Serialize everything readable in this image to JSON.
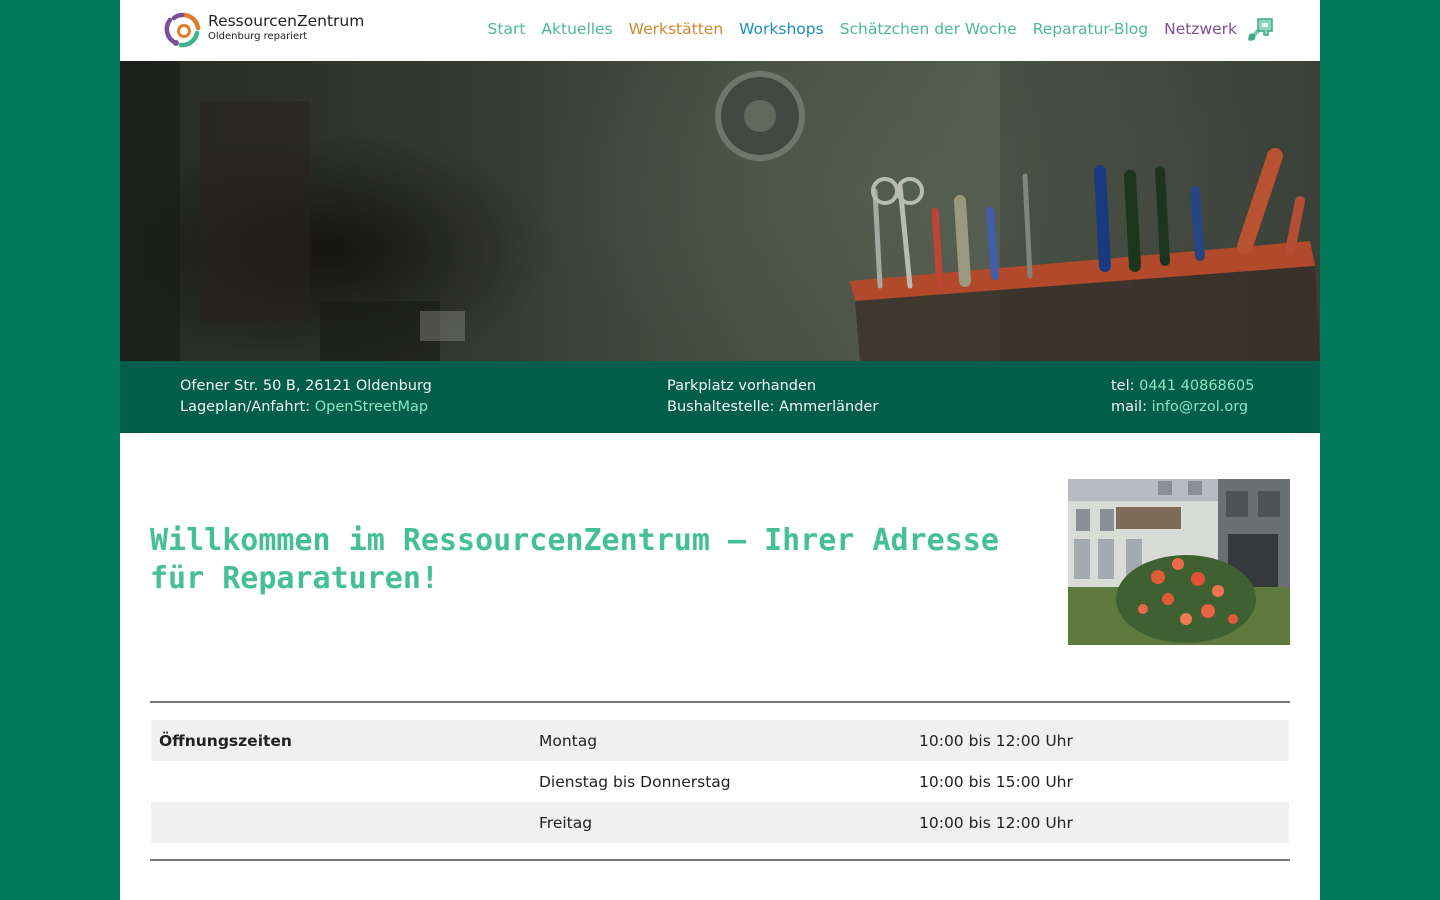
{
  "header": {
    "logo": {
      "name": "RessourcenZentrum",
      "subtitle": "Oldenburg repariert",
      "icon": "circular-arrows-logo-icon"
    },
    "nav": [
      {
        "label": "Start",
        "color": "#4db89a"
      },
      {
        "label": "Aktuelles",
        "color": "#4db89a"
      },
      {
        "label": "Werkstätten",
        "color": "#d08a30"
      },
      {
        "label": "Workshops",
        "color": "#1a8fb8"
      },
      {
        "label": "Schätzchen der Woche",
        "color": "#4db89a"
      },
      {
        "label": "Reparatur-Blog",
        "color": "#4db89a"
      },
      {
        "label": "Netzwerk",
        "color": "#7d4e99"
      }
    ],
    "network_icon": "puzzle-network-icon"
  },
  "hero": {
    "icon": "workshop-tools-photo"
  },
  "info": {
    "address": "Ofener Str. 50 B, 26121 Oldenburg",
    "map_prefix": "Lageplan/Anfahrt: ",
    "map_link": "OpenStreetMap",
    "parking": "Parkplatz vorhanden",
    "bus": "Bushaltestelle: Ammerländer",
    "tel_prefix": "tel: ",
    "tel": "0441 40868605",
    "mail_prefix": "mail: ",
    "mail": "info@rzol.org"
  },
  "welcome": {
    "title": "Willkommen im RessourcenZentrum – Ihrer Adresse für Reparaturen!",
    "image": "building-with-roses-photo"
  },
  "hours": {
    "heading": "Öffnungszeiten",
    "rows": [
      {
        "label": "Öffnungszeiten",
        "day": "Montag",
        "time": "10:00 bis 12:00 Uhr"
      },
      {
        "label": "",
        "day": "Dienstag bis Donnerstag",
        "time": "10:00 bis 15:00 Uhr"
      },
      {
        "label": "",
        "day": "Freitag",
        "time": "10:00 bis 12:00 Uhr"
      }
    ]
  },
  "colors": {
    "background": "#00785a",
    "info_bar": "#025e4b",
    "title": "#45c096",
    "link_light": "#8ee3c4"
  }
}
